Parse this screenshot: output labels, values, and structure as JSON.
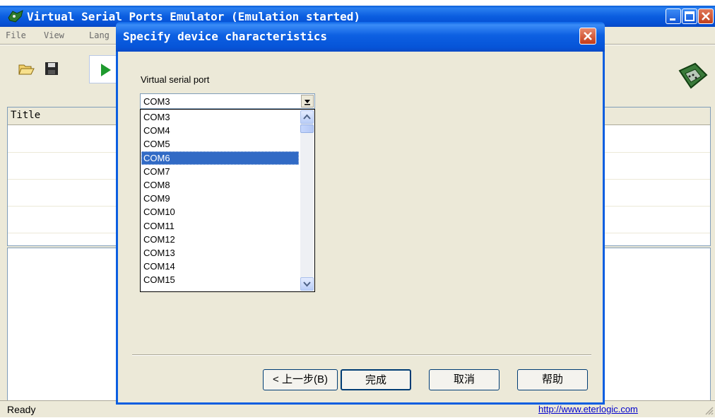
{
  "main_window": {
    "title": "Virtual Serial Ports Emulator (Emulation started)",
    "menu": [
      "File",
      "View",
      "Lang"
    ],
    "toolbar": {
      "icons": [
        "open-folder-icon",
        "save-disk-icon",
        "play-icon",
        "serial-connector-icon"
      ]
    },
    "list": {
      "column_title": "Title"
    },
    "status": {
      "text": "Ready",
      "link": "http://www.eterlogic.com"
    }
  },
  "dialog": {
    "title": "Specify device characteristics",
    "port_label": "Virtual serial port",
    "combo_value": "COM3",
    "options": [
      "COM3",
      "COM4",
      "COM5",
      "COM6",
      "COM7",
      "COM8",
      "COM9",
      "COM10",
      "COM11",
      "COM12",
      "COM13",
      "COM14",
      "COM15"
    ],
    "highlighted_option": "COM6",
    "buttons": {
      "back": "< 上一步(B)",
      "finish": "完成",
      "cancel": "取消",
      "help": "帮助"
    }
  },
  "colors": {
    "title_bar_blue": "#0b5ee0",
    "selection_blue": "#316ac5",
    "link_blue": "#0000cc",
    "face": "#ece9d8"
  }
}
